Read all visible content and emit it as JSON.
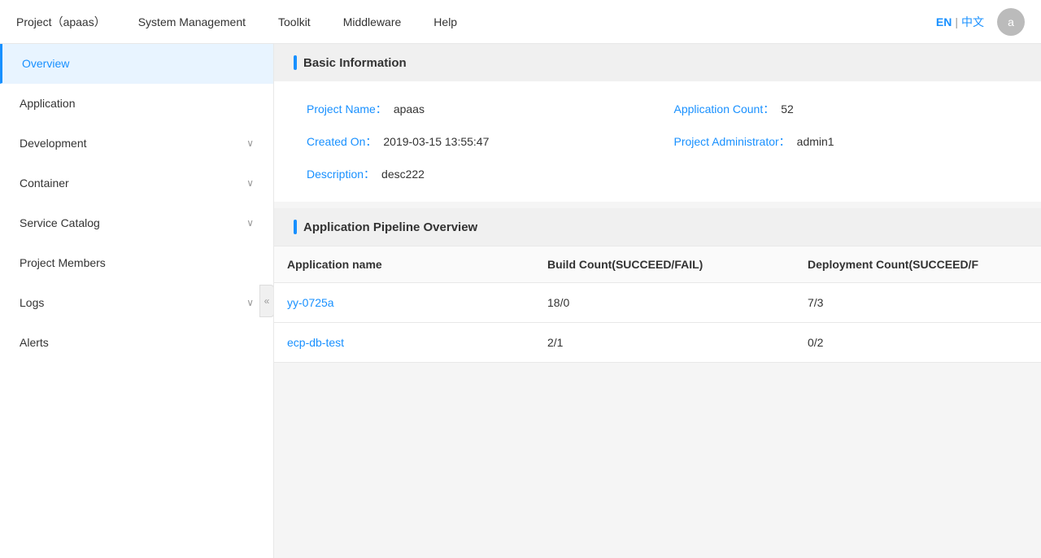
{
  "topNav": {
    "items": [
      {
        "id": "project",
        "label": "Project（apaas）"
      },
      {
        "id": "system",
        "label": "System Management"
      },
      {
        "id": "toolkit",
        "label": "Toolkit"
      },
      {
        "id": "middleware",
        "label": "Middleware"
      },
      {
        "id": "help",
        "label": "Help"
      }
    ],
    "langEN": "EN",
    "langSep": "|",
    "langZH": "中文",
    "avatarLabel": "a"
  },
  "sidebar": {
    "items": [
      {
        "id": "overview",
        "label": "Overview",
        "active": true,
        "hasChevron": false
      },
      {
        "id": "application",
        "label": "Application",
        "active": false,
        "hasChevron": false
      },
      {
        "id": "development",
        "label": "Development",
        "active": false,
        "hasChevron": true
      },
      {
        "id": "container",
        "label": "Container",
        "active": false,
        "hasChevron": true
      },
      {
        "id": "service-catalog",
        "label": "Service Catalog",
        "active": false,
        "hasChevron": true
      },
      {
        "id": "project-members",
        "label": "Project Members",
        "active": false,
        "hasChevron": false
      },
      {
        "id": "logs",
        "label": "Logs",
        "active": false,
        "hasChevron": true
      },
      {
        "id": "alerts",
        "label": "Alerts",
        "active": false,
        "hasChevron": false
      }
    ],
    "collapseIcon": "«"
  },
  "basicInfo": {
    "sectionTitle": "Basic Information",
    "fields": [
      {
        "id": "project-name",
        "label": "Project Name：",
        "value": "apaas"
      },
      {
        "id": "app-count",
        "label": "Application Count：",
        "value": "52"
      },
      {
        "id": "created-on",
        "label": "Created On：",
        "value": "2019-03-15 13:55:47"
      },
      {
        "id": "project-admin",
        "label": "Project Administrator：",
        "value": "admin1"
      },
      {
        "id": "description",
        "label": "Description：",
        "value": "desc222"
      }
    ]
  },
  "pipeline": {
    "sectionTitle": "Application Pipeline Overview",
    "columns": [
      {
        "id": "app-name",
        "label": "Application name"
      },
      {
        "id": "build-count",
        "label": "Build Count(SUCCEED/FAIL)"
      },
      {
        "id": "deploy-count",
        "label": "Deployment Count(SUCCEED/F"
      }
    ],
    "rows": [
      {
        "appName": "yy-0725a",
        "buildCount": "18/0",
        "deployCount": "7/3"
      },
      {
        "appName": "ecp-db-test",
        "buildCount": "2/1",
        "deployCount": "0/2"
      }
    ]
  }
}
